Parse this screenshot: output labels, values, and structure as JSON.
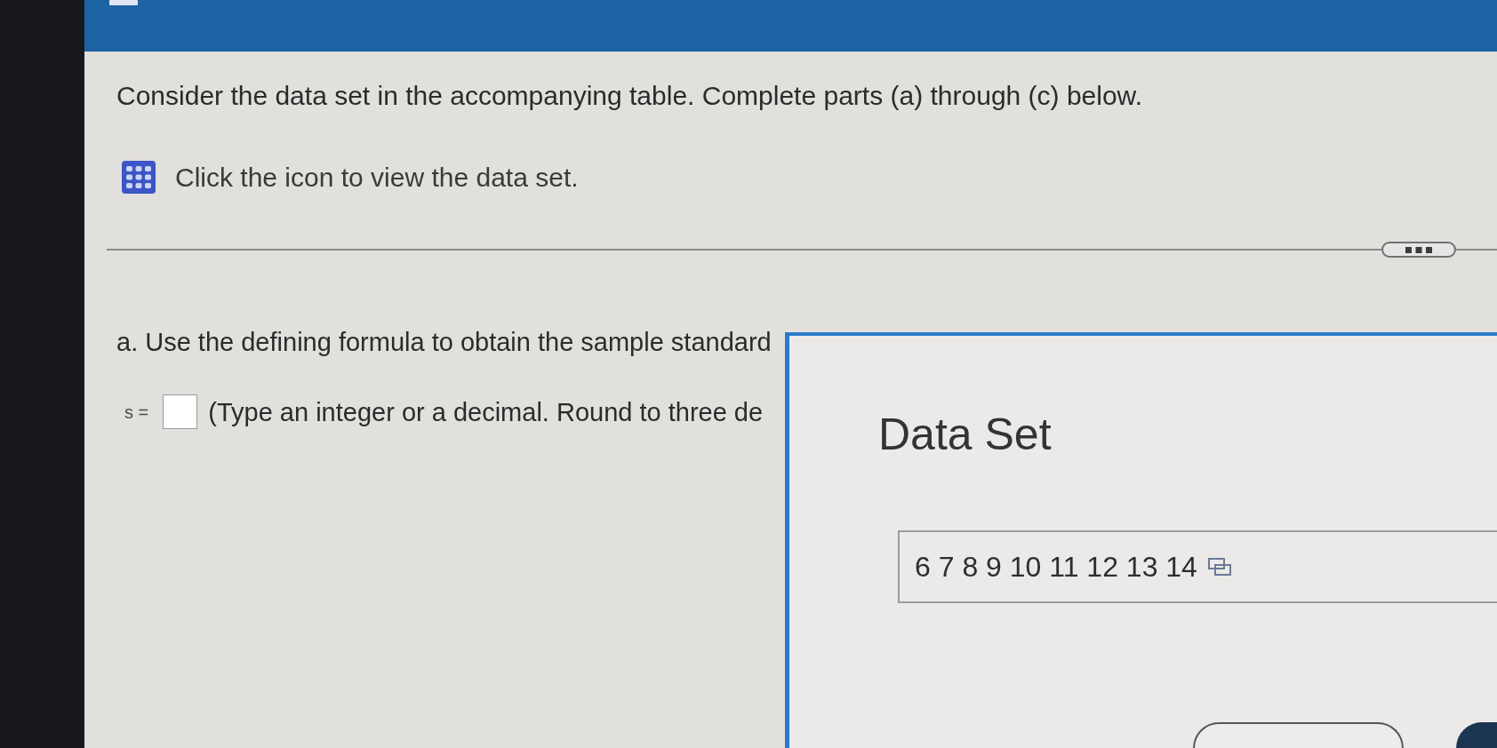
{
  "question": {
    "prompt": "Consider the data set in the accompanying table. Complete parts (a) through (c) below.",
    "data_link": "Click the icon to view the data set."
  },
  "part_a": {
    "instruction": "a. Use the defining formula to obtain the sample standard",
    "answer_label": "s =",
    "hint": "(Type an integer or a decimal. Round to three de"
  },
  "data_set_window": {
    "title": "Data Set",
    "values": "6 7 8 9 10 11 12 13 14"
  }
}
